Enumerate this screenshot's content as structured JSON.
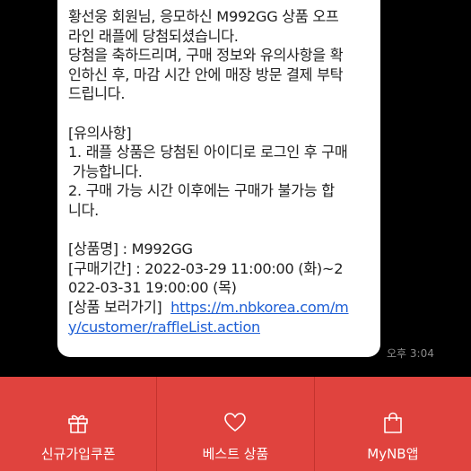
{
  "message": {
    "lines": [
      "황선웅 회원님, 응모하신 M992GG 상품 오프",
      "라인 래플에 당첨되셨습니다.",
      "당첨을 축하드리며, 구매 정보와 유의사항을 확",
      "인하신 후, 마감 시간 안에 매장 방문 결제 부탁",
      "드립니다.",
      "",
      "[유의사항]",
      "1. 래플 상품은 당첨된 아이디로 로그인 후 구매",
      " 가능합니다.",
      "2. 구매 가능 시간 이후에는 구매가 불가능 합",
      "니다.",
      "",
      "[상품명] : M992GG",
      "[구매기간] : 2022-03-29 11:00:00 (화)~2",
      "022-03-31 19:00:00 (목)"
    ],
    "link_prefix": "[상품 보러가기]  ",
    "link_line1": "https://m.nbkorea.com/m",
    "link_line2": "y/customer/raffleList.action",
    "time": "오후 3:04"
  },
  "tabbar": {
    "background": "#e0433e",
    "tabs": [
      {
        "label": "신규가입쿠폰",
        "icon": "gift-icon"
      },
      {
        "label": "베스트 상품",
        "icon": "heart-icon"
      },
      {
        "label": "MyNB앱",
        "icon": "shopping-bag-icon"
      }
    ]
  }
}
